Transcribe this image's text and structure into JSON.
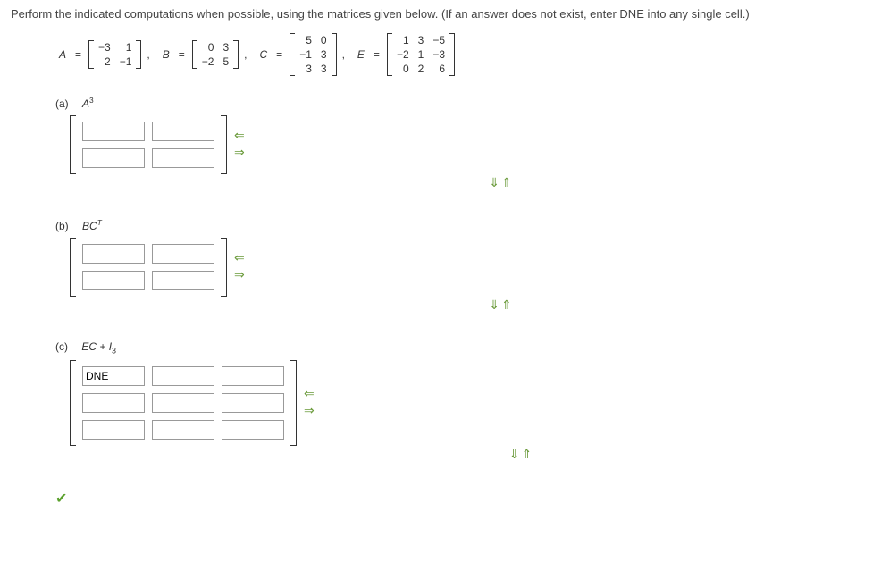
{
  "instruction": "Perform the indicated computations when possible, using the matrices given below. (If an answer does not exist, enter DNE into any single cell.)",
  "labels": {
    "A": "A",
    "B": "B",
    "C": "C",
    "E": "E",
    "eq": "="
  },
  "matrices": {
    "A": [
      [
        "−3",
        "1"
      ],
      [
        "2",
        "−1"
      ]
    ],
    "B": [
      [
        "0",
        "3"
      ],
      [
        "−2",
        "5"
      ]
    ],
    "C": [
      [
        "5",
        "0"
      ],
      [
        "−1",
        "3"
      ],
      [
        "3",
        "3"
      ]
    ],
    "E": [
      [
        "1",
        "3",
        "−5"
      ],
      [
        "−2",
        "1",
        "−3"
      ],
      [
        "0",
        "2",
        "6"
      ]
    ]
  },
  "parts": {
    "a": {
      "letter": "(a)",
      "expr_html": "A",
      "sup": "3"
    },
    "b": {
      "letter": "(b)",
      "expr_html": "BC",
      "sup": "T"
    },
    "c": {
      "letter": "(c)",
      "expr_html": "EC + I",
      "sub": "3"
    }
  },
  "answers": {
    "a": [
      [
        "",
        ""
      ],
      [
        "",
        ""
      ]
    ],
    "b": [
      [
        "",
        ""
      ],
      [
        "",
        ""
      ]
    ],
    "c": [
      [
        "DNE",
        "",
        ""
      ],
      [
        "",
        "",
        ""
      ],
      [
        "",
        "",
        ""
      ]
    ]
  },
  "arrows": {
    "left": "⇐",
    "right": "⇒",
    "down": "⇓",
    "up": "⇑"
  },
  "footer": {
    "check": "✔"
  }
}
